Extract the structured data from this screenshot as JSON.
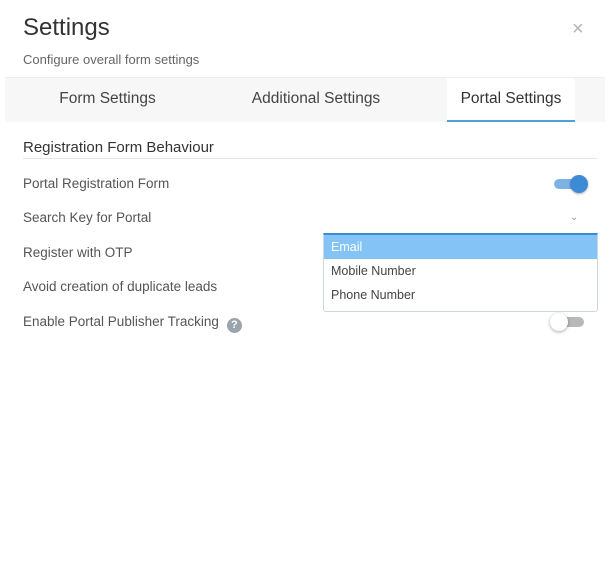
{
  "header": {
    "title": "Settings",
    "subtitle": "Configure overall form settings",
    "close_label": "×"
  },
  "tabs": [
    {
      "label": "Form Settings"
    },
    {
      "label": "Additional Settings"
    },
    {
      "label": "Portal Settings",
      "active": true
    }
  ],
  "section": {
    "title": "Registration Form Behaviour",
    "rows": [
      {
        "label": "Portal Registration Form",
        "toggle": "on"
      },
      {
        "label": "Search Key for Portal",
        "control": "select",
        "value": "Email"
      },
      {
        "label": "Register with OTP"
      },
      {
        "label": "Avoid creation of duplicate leads"
      },
      {
        "label": "Enable Portal Publisher Tracking",
        "help": "?",
        "toggle": "off"
      }
    ]
  },
  "dropdown": {
    "options": [
      "Email",
      "Mobile Number",
      "Phone Number"
    ],
    "selected": "Email"
  },
  "colors": {
    "accent": "#3d8bd4",
    "selected_option": "#83c3f5"
  }
}
